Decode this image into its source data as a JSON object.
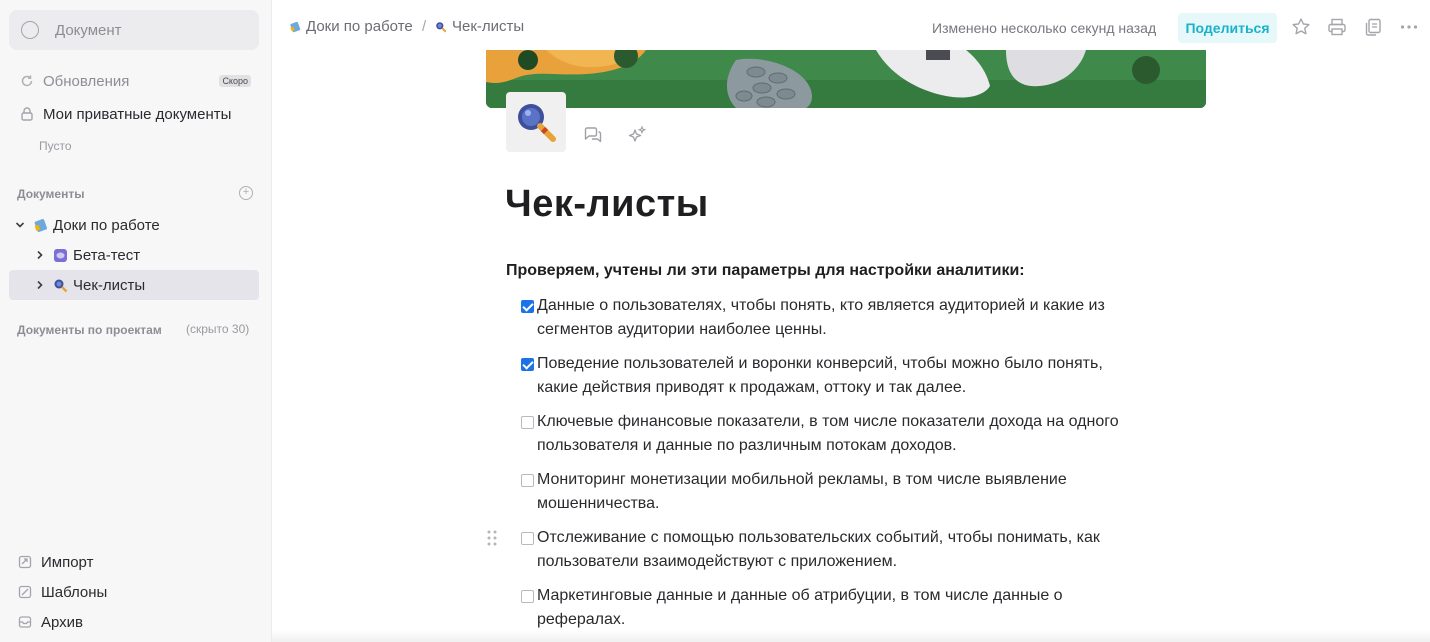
{
  "sidebar": {
    "search_placeholder": "Документ",
    "updates_label": "Обновления",
    "updates_badge": "Скоро",
    "private_label": "Мои приватные документы",
    "private_empty": "Пусто",
    "documents_header": "Документы",
    "tree": [
      {
        "label": "Доки по работе",
        "icon": "blue-notebook-icon",
        "expanded": true
      },
      {
        "label": "Бета-тест",
        "icon": "purple-disk-icon",
        "expanded": false
      },
      {
        "label": "Чек-листы",
        "icon": "magnifier-icon",
        "expanded": false,
        "selected": true
      }
    ],
    "projects_header": "Документы по проектам",
    "projects_hidden": "(скрыто 30)",
    "bottom": [
      {
        "label": "Импорт",
        "icon": "import-icon"
      },
      {
        "label": "Шаблоны",
        "icon": "templates-icon"
      },
      {
        "label": "Архив",
        "icon": "archive-icon"
      }
    ]
  },
  "topbar": {
    "breadcrumb": [
      "Доки по работе",
      "Чек-листы"
    ],
    "breadcrumb_separator": "/",
    "modified": "Изменено несколько секунд назад",
    "share_label": "Поделиться",
    "icons": [
      "star-icon",
      "print-icon",
      "copy-icon",
      "more-icon"
    ]
  },
  "document": {
    "title": "Чек-листы",
    "intro": "Проверяем, учтены ли эти параметры для настройки аналитики:",
    "tasks": [
      {
        "checked": true,
        "line1": "Данные о пользователях, чтобы понять, кто является аудиторией и какие из",
        "line2": "сегментов аудитории наиболее ценны."
      },
      {
        "checked": true,
        "line1": "Поведение пользователей и воронки конверсий, чтобы можно было понять,",
        "line2": "какие действия приводят к продажам, оттоку и так далее."
      },
      {
        "checked": false,
        "line1": "Ключевые финансовые показатели, в том числе показатели дохода на одного",
        "line2": "пользователя и данные по различным потокам доходов."
      },
      {
        "checked": false,
        "line1": "Мониторинг монетизации мобильной рекламы, в том числе выявление",
        "line2": "мошенничества."
      },
      {
        "checked": false,
        "line1": "Отслеживание с помощью пользовательских событий, чтобы понимать, как",
        "line2": "пользователи взаимодействуют с приложением."
      },
      {
        "checked": false,
        "line1": "Маркетинговые данные и данные об атрибуции, в том числе данные о",
        "line2": "рефералах."
      }
    ]
  },
  "colors": {
    "accent": "#1ab2c9",
    "checkbox": "#1a73e8",
    "selected_row": "#e4e4ea"
  }
}
